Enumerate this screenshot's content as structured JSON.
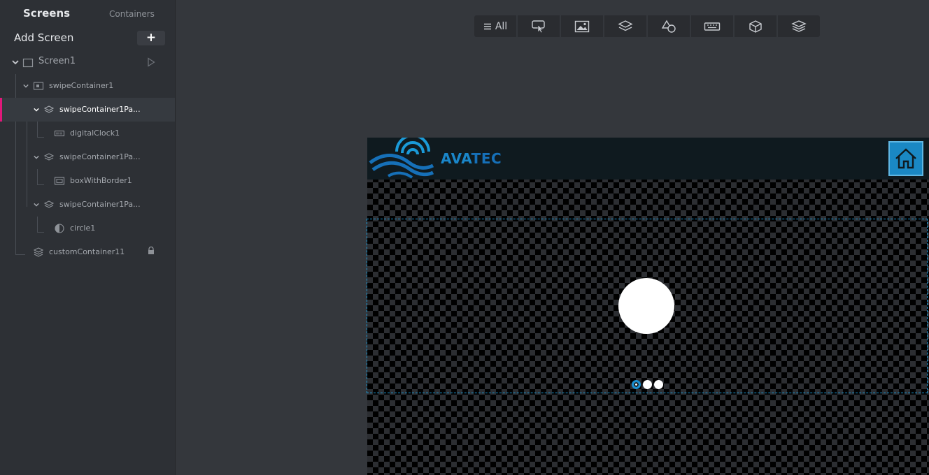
{
  "sidebar": {
    "tabs": {
      "screens": "Screens",
      "containers": "Containers"
    },
    "add_screen_label": "Add Screen",
    "add_button_icon": "+",
    "tree": [
      {
        "label": "Screen1"
      },
      {
        "label": "swipeContainer1"
      },
      {
        "label": "swipeContainer1Pa..."
      },
      {
        "label": "digitalClock1"
      },
      {
        "label": "swipeContainer1Pa..."
      },
      {
        "label": "boxWithBorder1"
      },
      {
        "label": "swipeContainer1Pa..."
      },
      {
        "label": "circle1"
      },
      {
        "label": "customContainer11"
      }
    ]
  },
  "toolbar": {
    "all_label": "All",
    "buttons": [
      "interaction-icon",
      "image-icon",
      "layers-icon",
      "shapes-icon",
      "keyboard-icon",
      "cube-icon",
      "stack-icon"
    ]
  },
  "canvas": {
    "brand_part1": "AVA",
    "brand_part2": "TEC",
    "pagination": {
      "count": 3,
      "active": 1
    }
  },
  "colors": {
    "accent": "#1a9ad8",
    "selection": "#e0187a",
    "brand_blue": "#1a86c9"
  }
}
